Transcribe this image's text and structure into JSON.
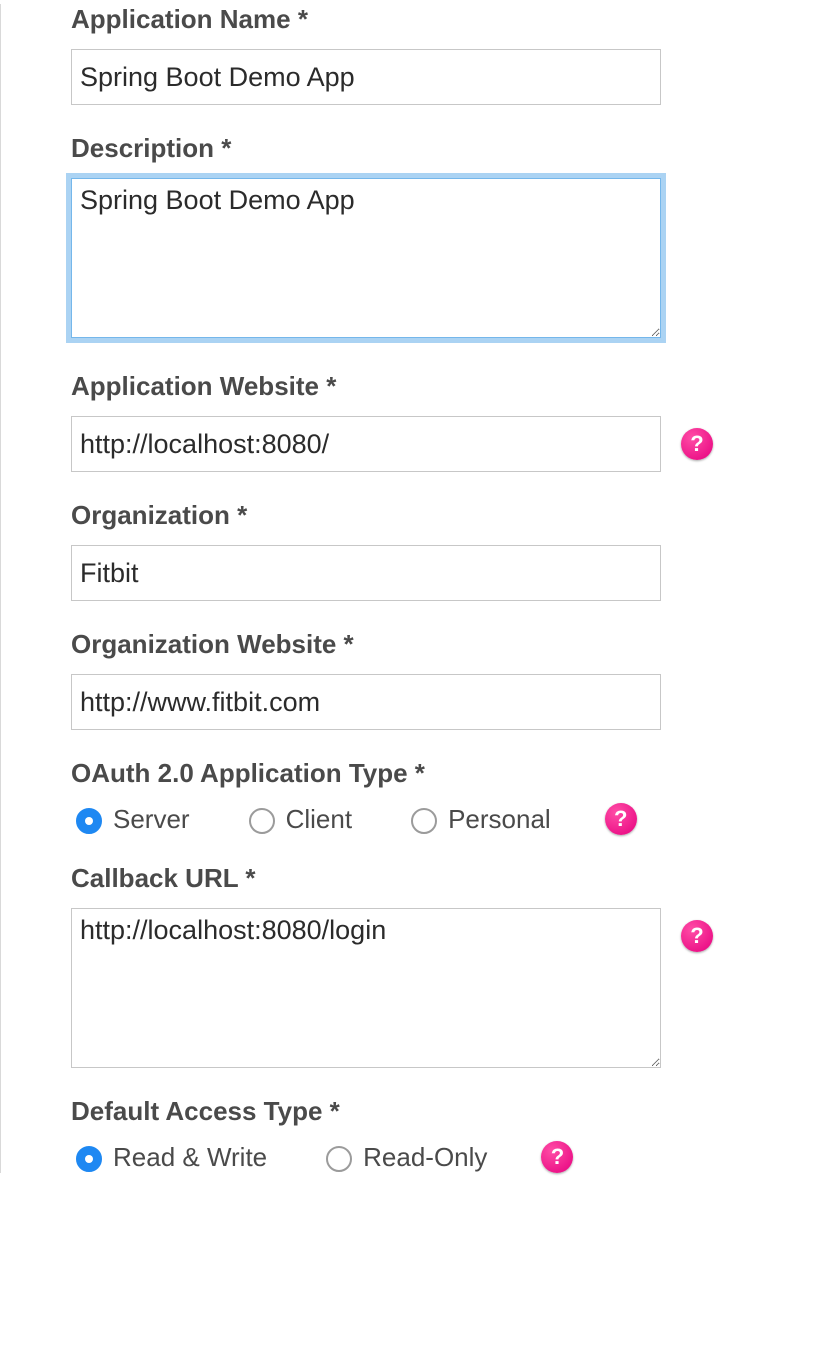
{
  "form": {
    "app_name": {
      "label": "Application Name *",
      "value": "Spring Boot Demo App"
    },
    "description": {
      "label": "Description *",
      "value": "Spring Boot Demo App"
    },
    "app_website": {
      "label": "Application Website *",
      "value": "http://localhost:8080/"
    },
    "organization": {
      "label": "Organization *",
      "value": "Fitbit"
    },
    "org_website": {
      "label": "Organization Website *",
      "value": "http://www.fitbit.com"
    },
    "oauth_type": {
      "label": "OAuth 2.0 Application Type *",
      "options": {
        "server": "Server",
        "client": "Client",
        "personal": "Personal"
      },
      "selected": "server"
    },
    "callback": {
      "label": "Callback URL *",
      "value": "http://localhost:8080/login"
    },
    "access_type": {
      "label": "Default Access Type *",
      "options": {
        "rw": "Read & Write",
        "ro": "Read-Only"
      },
      "selected": "rw"
    }
  },
  "help_glyph": "?"
}
